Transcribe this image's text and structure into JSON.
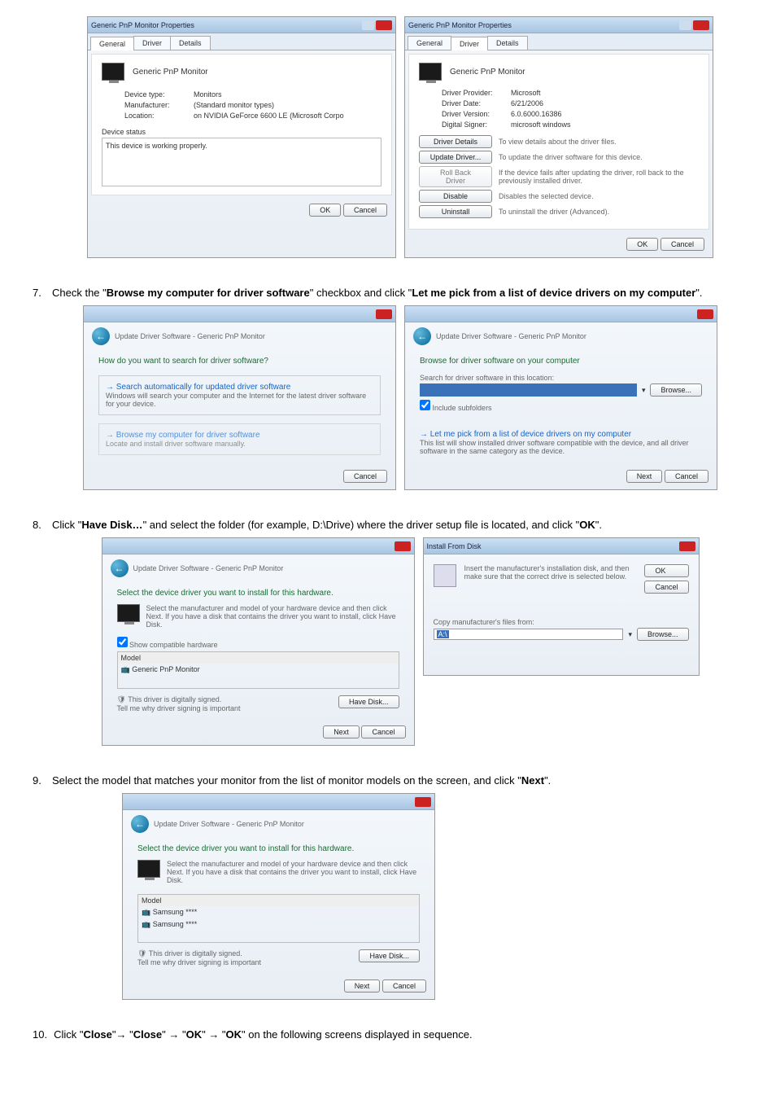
{
  "step6": {
    "props1": {
      "title": "Generic PnP Monitor Properties",
      "tab_general": "General",
      "tab_driver": "Driver",
      "tab_details": "Details",
      "device_name": "Generic PnP Monitor",
      "device_type_lbl": "Device type:",
      "device_type": "Monitors",
      "manufacturer_lbl": "Manufacturer:",
      "manufacturer": "(Standard monitor types)",
      "location_lbl": "Location:",
      "location": "on NVIDIA GeForce 6600 LE (Microsoft Corpo",
      "status_lbl": "Device status",
      "status": "This device is working properly.",
      "ok": "OK",
      "cancel": "Cancel"
    },
    "props2": {
      "title": "Generic PnP Monitor Properties",
      "tab_general": "General",
      "tab_driver": "Driver",
      "tab_details": "Details",
      "device_name": "Generic PnP Monitor",
      "provider_lbl": "Driver Provider:",
      "provider": "Microsoft",
      "date_lbl": "Driver Date:",
      "date": "6/21/2006",
      "version_lbl": "Driver Version:",
      "version": "6.0.6000.16386",
      "signer_lbl": "Digital Signer:",
      "signer": "microsoft windows",
      "btn_details": "Driver Details",
      "btn_details_desc": "To view details about the driver files.",
      "btn_update": "Update Driver...",
      "btn_update_desc": "To update the driver software for this device.",
      "btn_rollback": "Roll Back Driver",
      "btn_rollback_desc": "If the device fails after updating the driver, roll back to the previously installed driver.",
      "btn_disable": "Disable",
      "btn_disable_desc": "Disables the selected device.",
      "btn_uninstall": "Uninstall",
      "btn_uninstall_desc": "To uninstall the driver (Advanced).",
      "ok": "OK",
      "cancel": "Cancel"
    }
  },
  "step7": {
    "num": "7.",
    "text_a": "Check the \"",
    "bold_a": "Browse my computer for driver software",
    "text_b": "\" checkbox and click \"",
    "bold_b": "Let me pick from a list of device drivers on my computer",
    "text_c": "\".",
    "wiz1": {
      "crumb": "Update Driver Software - Generic PnP Monitor",
      "q": "How do you want to search for driver software?",
      "opt1_h": "Search automatically for updated driver software",
      "opt1_d": "Windows will search your computer and the Internet for the latest driver software for your device.",
      "opt2_h": "Browse my computer for driver software",
      "opt2_d": "Locate and install driver software manually.",
      "cancel": "Cancel"
    },
    "wiz2": {
      "crumb": "Update Driver Software - Generic PnP Monitor",
      "q": "Browse for driver software on your computer",
      "loc_lbl": "Search for driver software in this location:",
      "browse": "Browse...",
      "chk": "Include subfolders",
      "pick_h": "Let me pick from a list of device drivers on my computer",
      "pick_d": "This list will show installed driver software compatible with the device, and all driver software in the same category as the device.",
      "next": "Next",
      "cancel": "Cancel"
    }
  },
  "step8": {
    "num": "8.",
    "text_a": "Click \"",
    "bold_a": "Have Disk…",
    "text_b": "\" and select the folder (for example, D:\\Drive) where the driver setup file is located, and click \"",
    "bold_b": "OK",
    "text_c": "\".",
    "wiz": {
      "crumb": "Update Driver Software - Generic PnP Monitor",
      "h": "Select the device driver you want to install for this hardware.",
      "d": "Select the manufacturer and model of your hardware device and then click Next. If you have a disk that contains the driver you want to install, click Have Disk.",
      "chk": "Show compatible hardware",
      "model_lbl": "Model",
      "model": "Generic PnP Monitor",
      "signed": "This driver is digitally signed.",
      "why": "Tell me why driver signing is important",
      "have": "Have Disk...",
      "next": "Next",
      "cancel": "Cancel"
    },
    "dlg": {
      "title": "Install From Disk",
      "msg": "Insert the manufacturer's installation disk, and then make sure that the correct drive is selected below.",
      "ok": "OK",
      "cancel": "Cancel",
      "copy_lbl": "Copy manufacturer's files from:",
      "path": "A:\\",
      "browse": "Browse..."
    }
  },
  "step9": {
    "num": "9.",
    "text_a": "Select the model that matches your monitor from the list of monitor models on the screen, and click \"",
    "bold_a": "Next",
    "text_b": "\".",
    "wiz": {
      "crumb": "Update Driver Software - Generic PnP Monitor",
      "h": "Select the device driver you want to install for this hardware.",
      "d": "Select the manufacturer and model of your hardware device and then click Next. If you have a disk that contains the driver you want to install, click Have Disk.",
      "model_lbl": "Model",
      "m1": "Samsung ****",
      "m2": "Samsung ****",
      "signed": "This driver is digitally signed.",
      "why": "Tell me why driver signing is important",
      "have": "Have Disk...",
      "next": "Next",
      "cancel": "Cancel"
    }
  },
  "step10": {
    "num": "10.",
    "text_a": "Click \"",
    "b1": "Close",
    "text_b": "\"→ \"",
    "b2": "Close",
    "text_c": "\" → \"",
    "b3": "OK",
    "text_d": "\" → \"",
    "b4": "OK",
    "text_e": "\" on the following screens displayed in sequence."
  }
}
